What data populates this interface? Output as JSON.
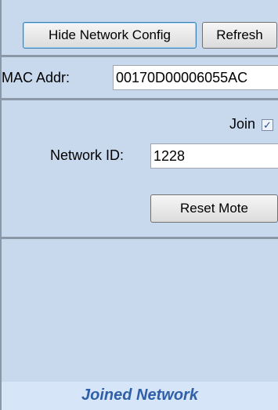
{
  "toolbar": {
    "hide_config_label": "Hide Network Config",
    "refresh_label": "Refresh"
  },
  "mac": {
    "label": "MAC Addr:",
    "value": "00170D00006055AC"
  },
  "network": {
    "join_label": "Join",
    "join_checked": true,
    "network_id_label": "Network ID:",
    "network_id_value": "1228",
    "reset_label": "Reset Mote"
  },
  "status": {
    "text": "Joined Network"
  },
  "colors": {
    "panel_bg": "#c8d9ee",
    "separator": "#8a98a8",
    "status_text": "#2f5fa6"
  },
  "icons": {
    "join_check": "checkmark-icon"
  }
}
